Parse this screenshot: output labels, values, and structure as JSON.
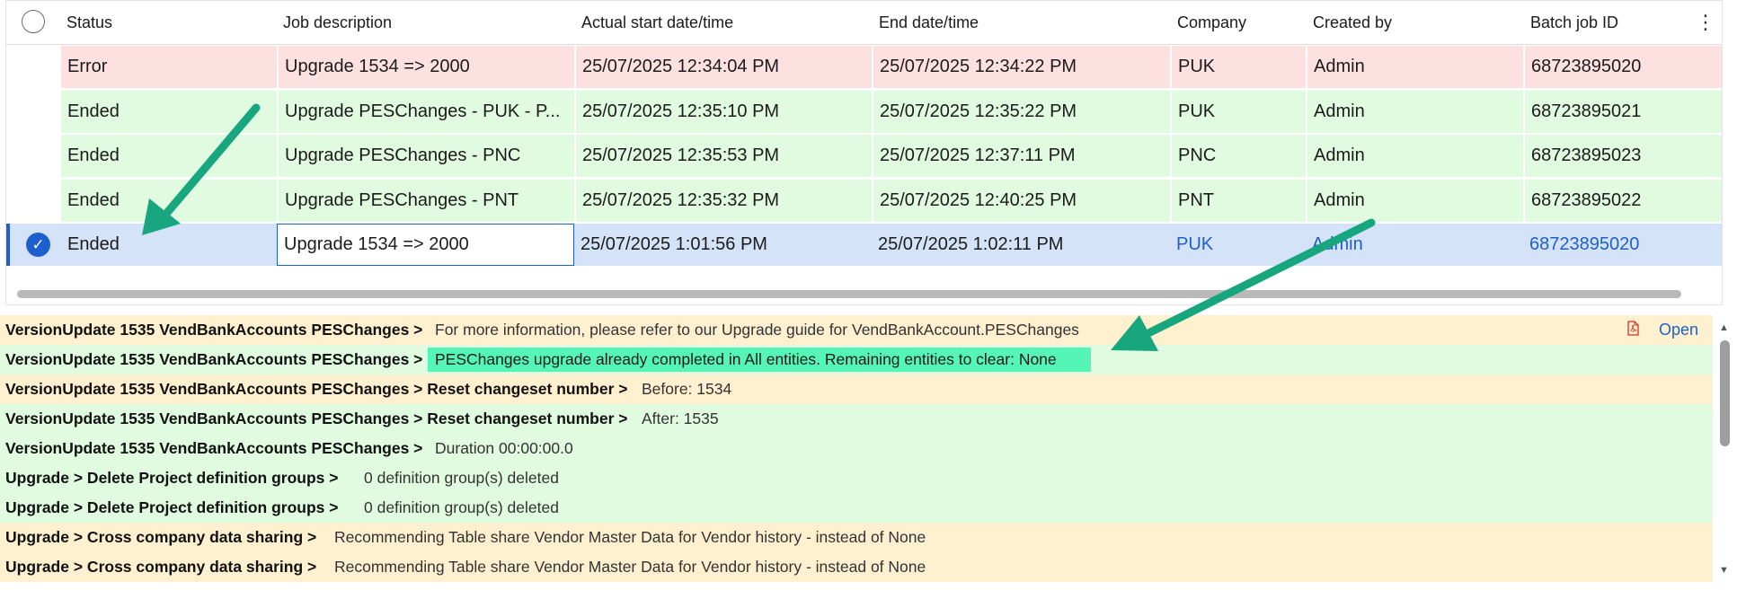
{
  "grid": {
    "columns": [
      "Status",
      "Job description",
      "Actual start date/time",
      "End date/time",
      "Company",
      "Created by",
      "Batch job ID"
    ],
    "more_icon": "more-vertical-icon",
    "rows": [
      {
        "status": "Error",
        "description": "Upgrade 1534 => 2000",
        "start": "25/07/2025 12:34:04 PM",
        "end": "25/07/2025 12:34:22 PM",
        "company": "PUK",
        "created_by": "Admin",
        "batch_id": "68723895020"
      },
      {
        "status": "Ended",
        "description": "Upgrade PESChanges - PUK - P...",
        "start": "25/07/2025 12:35:10 PM",
        "end": "25/07/2025 12:35:22 PM",
        "company": "PUK",
        "created_by": "Admin",
        "batch_id": "68723895021"
      },
      {
        "status": "Ended",
        "description": "Upgrade PESChanges - PNC",
        "start": "25/07/2025 12:35:53 PM",
        "end": "25/07/2025 12:37:11 PM",
        "company": "PNC",
        "created_by": "Admin",
        "batch_id": "68723895023"
      },
      {
        "status": "Ended",
        "description": "Upgrade PESChanges - PNT",
        "start": "25/07/2025 12:35:32 PM",
        "end": "25/07/2025 12:40:25 PM",
        "company": "PNT",
        "created_by": "Admin",
        "batch_id": "68723895022"
      },
      {
        "status": "Ended",
        "description": "Upgrade 1534 => 2000",
        "start": "25/07/2025 1:01:56 PM",
        "end": "25/07/2025 1:02:11 PM",
        "company": "PUK",
        "created_by": "Admin",
        "batch_id": "68723895020"
      }
    ]
  },
  "log": {
    "open_label": "Open",
    "rows": [
      {
        "path": "VersionUpdate 1535 VendBankAccounts PESChanges >",
        "message": "For more information, please refer to our Upgrade guide for VendBankAccount.PESChanges"
      },
      {
        "path": "VersionUpdate 1535 VendBankAccounts PESChanges >",
        "message": "PESChanges upgrade already completed in All entities. Remaining entities to clear: None"
      },
      {
        "path": "VersionUpdate 1535 VendBankAccounts PESChanges > Reset changeset number >",
        "message": "Before: 1534"
      },
      {
        "path": "VersionUpdate 1535 VendBankAccounts PESChanges > Reset changeset number >",
        "message": "After: 1535"
      },
      {
        "path": "VersionUpdate 1535 VendBankAccounts PESChanges >",
        "message": "Duration 00:00:00.0"
      },
      {
        "path": "Upgrade > Delete Project definition groups >",
        "message": "0 definition group(s) deleted"
      },
      {
        "path": "Upgrade > Delete Project definition groups >",
        "message": "0 definition group(s) deleted"
      },
      {
        "path": "Upgrade > Cross company data sharing >",
        "message": "Recommending Table share Vendor Master Data for Vendor history - instead of None"
      },
      {
        "path": "Upgrade > Cross company data sharing >",
        "message": "Recommending Table share Vendor Master Data for Vendor history - instead of None"
      }
    ]
  },
  "colors": {
    "error_row": "#fde0e0",
    "ended_row": "#e0fbe0",
    "selected_row": "#d5e3f8",
    "info_log": "#fff0cf",
    "ok_log": "#e0fbe0",
    "highlight": "#55f5b8",
    "arrow": "#17a67e",
    "accent": "#1d5fcf"
  }
}
